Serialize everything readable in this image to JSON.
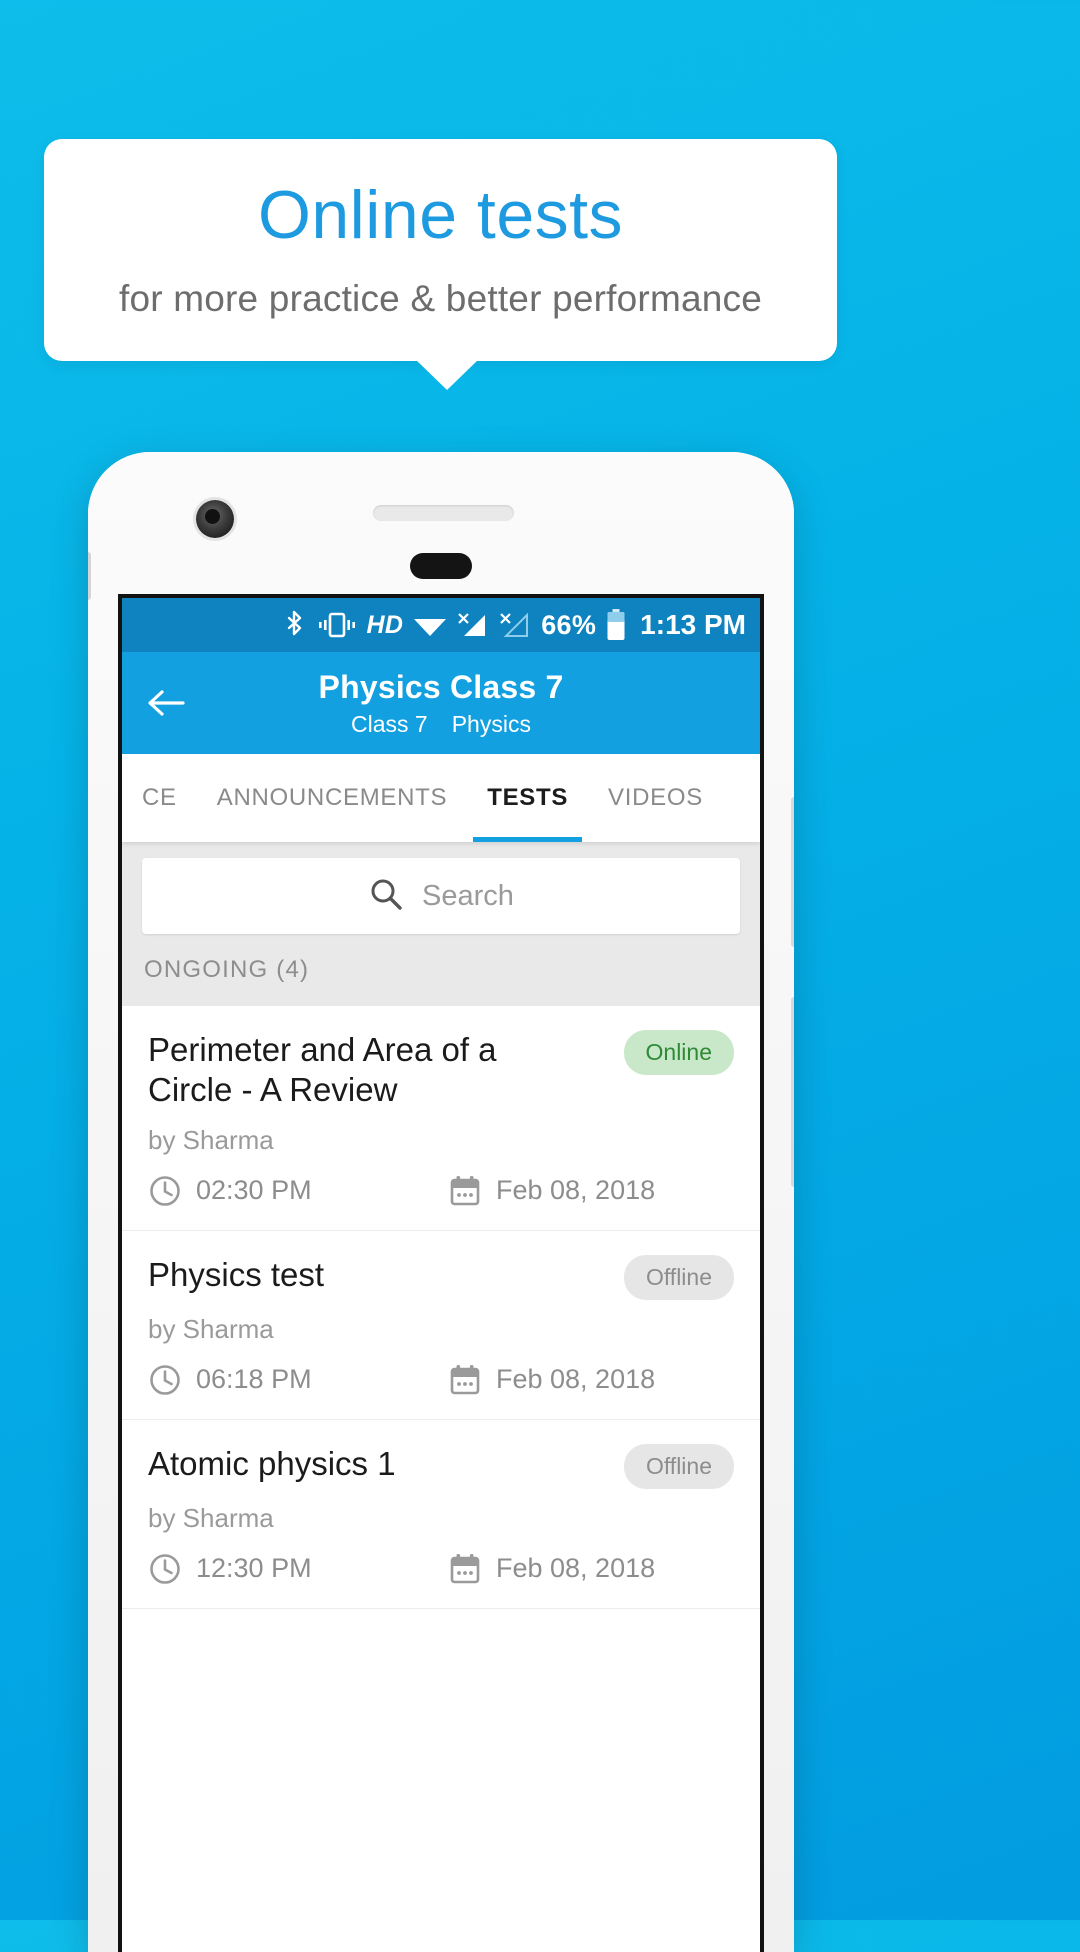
{
  "promo": {
    "title": "Online tests",
    "subtitle": "for more practice & better performance",
    "bg_color": "#05b3e8",
    "title_color": "#1e9be0"
  },
  "statusbar": {
    "icons": [
      "bluetooth-icon",
      "vibrate-icon",
      "hd-icon",
      "wifi-icon",
      "signal-1-icon",
      "signal-2-icon"
    ],
    "hd_label": "HD",
    "battery_percent": "66%",
    "time": "1:13 PM",
    "bg_color": "#0e83bf"
  },
  "appbar": {
    "back_icon": "back-arrow-icon",
    "title": "Physics Class 7",
    "subtitle_class": "Class 7",
    "subtitle_subject": "Physics",
    "bg_color": "#12a0e0"
  },
  "tabs": {
    "items": [
      {
        "label": "CE",
        "active": false
      },
      {
        "label": "ANNOUNCEMENTS",
        "active": false
      },
      {
        "label": "TESTS",
        "active": true
      },
      {
        "label": "VIDEOS",
        "active": false
      }
    ],
    "indicator_color": "#12a0e0"
  },
  "search": {
    "placeholder": "Search",
    "icon": "search-icon"
  },
  "section": {
    "label": "ONGOING (4)"
  },
  "tests": [
    {
      "title": "Perimeter and Area of a Circle - A Review",
      "author": "by Sharma",
      "status": "Online",
      "status_type": "online",
      "time": "02:30 PM",
      "date": "Feb 08, 2018"
    },
    {
      "title": "Physics test",
      "author": "by Sharma",
      "status": "Offline",
      "status_type": "offline",
      "time": "06:18 PM",
      "date": "Feb 08, 2018"
    },
    {
      "title": "Atomic physics 1",
      "author": "by Sharma",
      "status": "Offline",
      "status_type": "offline",
      "time": "12:30 PM",
      "date": "Feb 08, 2018"
    }
  ],
  "colors": {
    "online_badge_bg": "#c9e7c9",
    "online_badge_text": "#2f8a36",
    "offline_badge_bg": "#e6e6e6",
    "offline_badge_text": "#8d8d8d"
  }
}
